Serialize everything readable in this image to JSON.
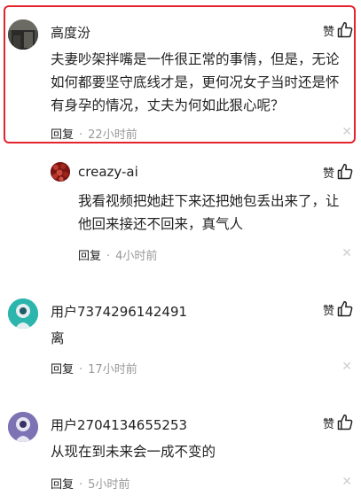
{
  "comments": [
    {
      "username": "高度汾",
      "like_label": "赞",
      "text": "夫妻吵架拌嘴是一件很正常的事情，但是，无论如何都要坚守底线才是，更何况女子当时还是怀有身孕的情况，丈夫为何如此狠心呢？",
      "reply_label": "回复",
      "time": "22小时前",
      "highlighted": true
    },
    {
      "username": "creazy-ai",
      "like_label": "赞",
      "text": "我看视频把她赶下来还把她包丢出来了，让他回来接还不回来，真气人",
      "reply_label": "回复",
      "time": "4小时前",
      "nested": true
    },
    {
      "username": "用户7374296142491",
      "like_label": "赞",
      "text": "离",
      "reply_label": "回复",
      "time": "17小时前"
    },
    {
      "username": "用户2704134655253",
      "like_label": "赞",
      "text": "从现在到未来会一成不变的",
      "reply_label": "回复",
      "time": "5小时前"
    }
  ],
  "colors": {
    "highlight_border": "#e5232c",
    "meta_time": "#999999",
    "avatar_teal": "#29b6b0",
    "avatar_purple": "#7b6fb0"
  },
  "icons": {
    "like": "thumbs-up-icon",
    "close": "close-icon"
  }
}
